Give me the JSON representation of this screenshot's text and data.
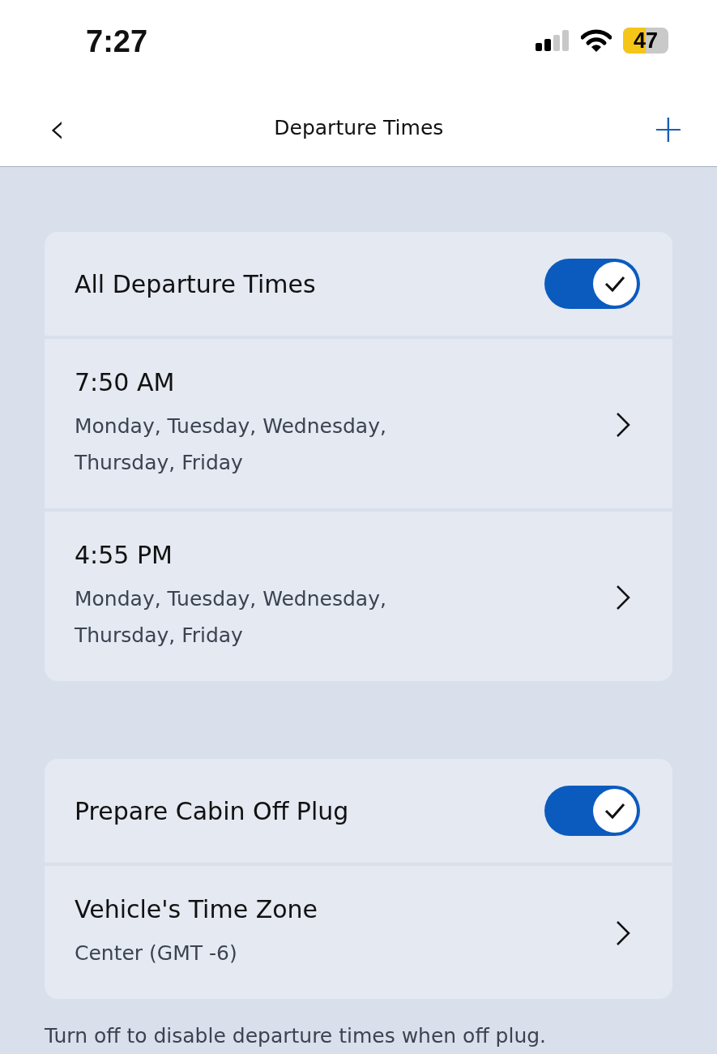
{
  "status_bar": {
    "time": "7:27",
    "battery": "47"
  },
  "nav": {
    "back": "‹",
    "title": "Departure Times",
    "add": "+"
  },
  "sections": [
    {
      "rows": [
        {
          "kind": "toggle",
          "title": "All Departure Times",
          "on": true
        },
        {
          "kind": "detail",
          "title": "7:50 AM",
          "subtitle": "Monday, Tuesday, Wednesday, Thursday, Friday"
        },
        {
          "kind": "detail",
          "title": "4:55 PM",
          "subtitle": "Monday, Tuesday, Wednesday, Thursday, Friday"
        }
      ]
    },
    {
      "rows": [
        {
          "kind": "toggle",
          "title": "Prepare Cabin Off Plug",
          "on": true
        },
        {
          "kind": "detail",
          "title": "Vehicle's Time Zone",
          "subtitle": "Center (GMT -6)"
        }
      ]
    }
  ],
  "footnote": "Turn off to disable departure times when off plug."
}
